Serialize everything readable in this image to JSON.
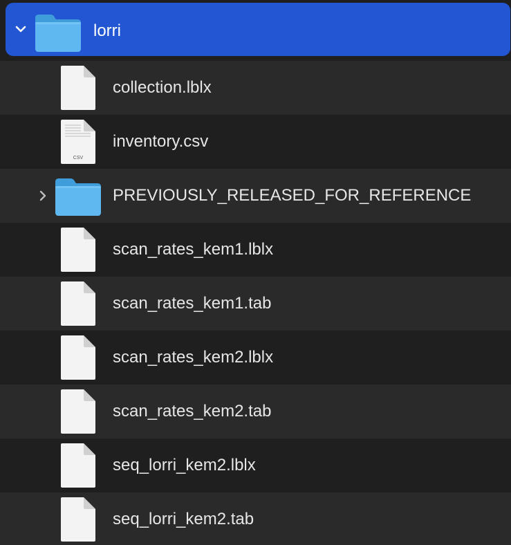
{
  "folder": {
    "name": "lorri",
    "expanded": true,
    "selected": true,
    "icon": "folder-icon"
  },
  "items": [
    {
      "name": "collection.lblx",
      "type": "file",
      "icon": "document-icon"
    },
    {
      "name": "inventory.csv",
      "type": "file",
      "icon": "csv-file-icon",
      "badge": "CSV"
    },
    {
      "name": "PREVIOUSLY_RELEASED_FOR_REFERENCE",
      "type": "folder",
      "icon": "folder-icon",
      "expanded": false
    },
    {
      "name": "scan_rates_kem1.lblx",
      "type": "file",
      "icon": "document-icon"
    },
    {
      "name": "scan_rates_kem1.tab",
      "type": "file",
      "icon": "document-icon"
    },
    {
      "name": "scan_rates_kem2.lblx",
      "type": "file",
      "icon": "document-icon"
    },
    {
      "name": "scan_rates_kem2.tab",
      "type": "file",
      "icon": "document-icon"
    },
    {
      "name": "seq_lorri_kem2.lblx",
      "type": "file",
      "icon": "document-icon"
    },
    {
      "name": "seq_lorri_kem2.tab",
      "type": "file",
      "icon": "document-icon"
    }
  ],
  "colors": {
    "selection": "#2256d2",
    "background": "#1f1f1f",
    "alt_row": "#2a2a2a",
    "text": "#e6e6e6",
    "folder_blue": "#5fb8ef"
  }
}
